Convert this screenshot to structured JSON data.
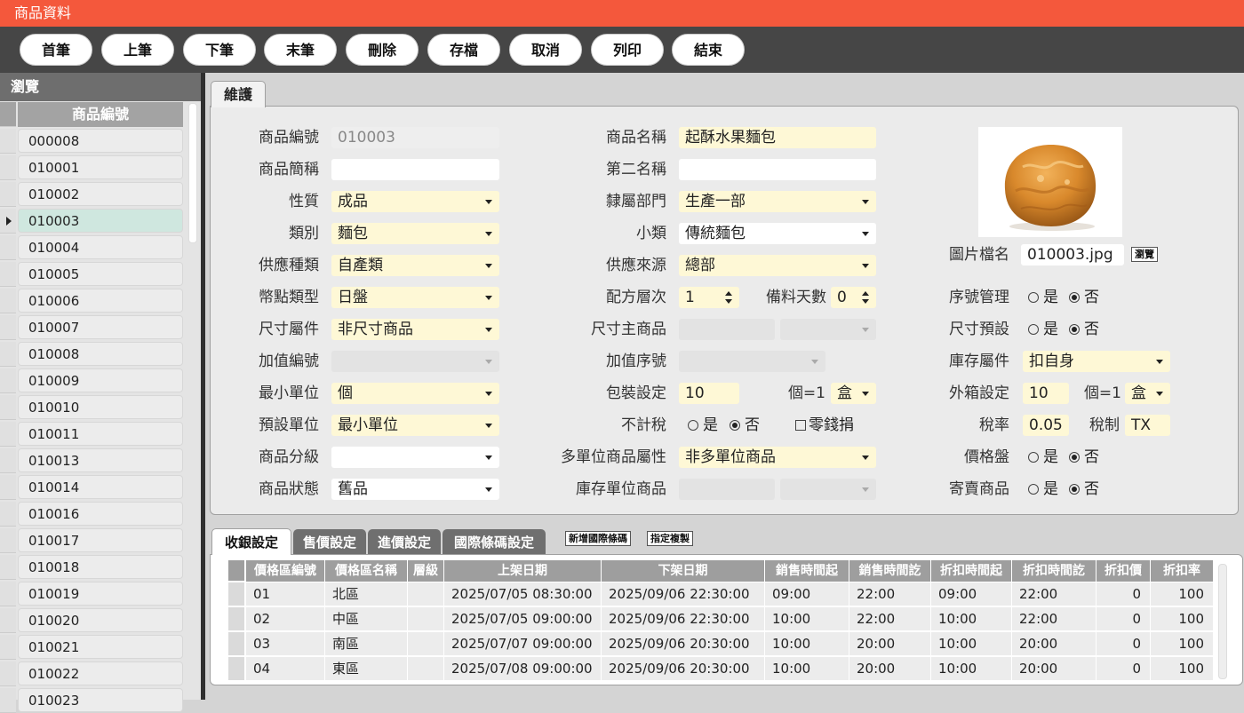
{
  "app": {
    "title": "商品資料"
  },
  "toolbar": {
    "buttons": [
      "首筆",
      "上筆",
      "下筆",
      "末筆",
      "刪除",
      "存檔",
      "取消",
      "列印",
      "結束"
    ]
  },
  "browse": {
    "title": "瀏覽",
    "column": "商品編號",
    "items": [
      "000008",
      "010001",
      "010002",
      "010003",
      "010004",
      "010005",
      "010006",
      "010007",
      "010008",
      "010009",
      "010010",
      "010011",
      "010013",
      "010014",
      "010016",
      "010017",
      "010018",
      "010019",
      "010020",
      "010021",
      "010022",
      "010023"
    ],
    "selected": "010003"
  },
  "tab": {
    "maintenance": "維護"
  },
  "form": {
    "product_no": {
      "label": "商品編號",
      "value": "010003"
    },
    "short_name": {
      "label": "商品簡稱",
      "value": ""
    },
    "nature": {
      "label": "性質",
      "value": "成品"
    },
    "category": {
      "label": "類別",
      "value": "麵包"
    },
    "supply_type": {
      "label": "供應種類",
      "value": "自產類"
    },
    "stocktake_type": {
      "label": "幣點類型",
      "value": "日盤"
    },
    "size_attr": {
      "label": "尺寸屬件",
      "value": "非尺寸商品"
    },
    "addon_no": {
      "label": "加值編號",
      "value": ""
    },
    "min_unit": {
      "label": "最小單位",
      "value": "個"
    },
    "default_unit": {
      "label": "預設單位",
      "value": "最小單位"
    },
    "grade": {
      "label": "商品分級",
      "value": ""
    },
    "status": {
      "label": "商品狀態",
      "value": "舊品"
    },
    "name": {
      "label": "商品名稱",
      "value": "起酥水果麵包"
    },
    "second_name": {
      "label": "第二名稱",
      "value": ""
    },
    "department": {
      "label": "隸屬部門",
      "value": "生產一部"
    },
    "subcategory": {
      "label": "小類",
      "value": "傳統麵包"
    },
    "supply_source": {
      "label": "供應來源",
      "value": "總部"
    },
    "recipe_level": {
      "label": "配方層次",
      "value": "1"
    },
    "prep_days": {
      "label": "備料天數",
      "value": "0"
    },
    "size_master": {
      "label": "尺寸主商品",
      "value": ""
    },
    "addon_seq": {
      "label": "加值序號",
      "value": ""
    },
    "package": {
      "label": "包裝設定",
      "value": "10",
      "per": "個=1",
      "unit": "盒"
    },
    "no_tax": {
      "label": "不計稅",
      "yes": "是",
      "no": "否",
      "selected": "否",
      "change_loss": "零錢捐"
    },
    "multi_unit": {
      "label": "多單位商品屬性",
      "value": "非多單位商品"
    },
    "stock_unit": {
      "label": "庫存單位商品",
      "value": ""
    },
    "image_file": {
      "label": "圖片檔名",
      "value": "010003.jpg",
      "browse": "瀏覽"
    },
    "serial_mgmt": {
      "label": "序號管理",
      "yes": "是",
      "no": "否",
      "selected": "否"
    },
    "size_default": {
      "label": "尺寸預設",
      "yes": "是",
      "no": "否",
      "selected": "否"
    },
    "stock_attr": {
      "label": "庫存屬件",
      "value": "扣自身"
    },
    "carton": {
      "label": "外箱設定",
      "value": "10",
      "per": "個=1",
      "unit": "盒"
    },
    "tax_rate": {
      "label": "稅率",
      "value": "0.05"
    },
    "tax_code": {
      "label": "稅制",
      "value": "TX"
    },
    "price_count": {
      "label": "價格盤",
      "yes": "是",
      "no": "否",
      "selected": "否"
    },
    "consignment": {
      "label": "寄賣商品",
      "yes": "是",
      "no": "否",
      "selected": "否"
    }
  },
  "bottom_tabs": {
    "tabs": [
      "收銀設定",
      "售價設定",
      "進價設定",
      "國際條碼設定"
    ],
    "active": "收銀設定",
    "add_barcode": "新增國際條碼",
    "assign_copy": "指定複製"
  },
  "grid": {
    "columns": [
      "價格區編號",
      "價格區名稱",
      "層級",
      "上架日期",
      "下架日期",
      "銷售時間起",
      "銷售時間訖",
      "折扣時間起",
      "折扣時間訖",
      "折扣價",
      "折扣率"
    ],
    "rows": [
      [
        "01",
        "北區",
        "",
        "2025/07/05 08:30:00",
        "2025/09/06 22:30:00",
        "09:00",
        "22:00",
        "09:00",
        "22:00",
        "0",
        "100"
      ],
      [
        "02",
        "中區",
        "",
        "2025/07/05 09:00:00",
        "2025/09/06 22:30:00",
        "10:00",
        "22:00",
        "10:00",
        "22:00",
        "0",
        "100"
      ],
      [
        "03",
        "南區",
        "",
        "2025/07/07 09:00:00",
        "2025/09/06 20:30:00",
        "10:00",
        "20:00",
        "10:00",
        "20:00",
        "0",
        "100"
      ],
      [
        "04",
        "東區",
        "",
        "2025/07/08 09:00:00",
        "2025/09/06 20:30:00",
        "10:00",
        "20:00",
        "10:00",
        "20:00",
        "0",
        "100"
      ]
    ]
  }
}
